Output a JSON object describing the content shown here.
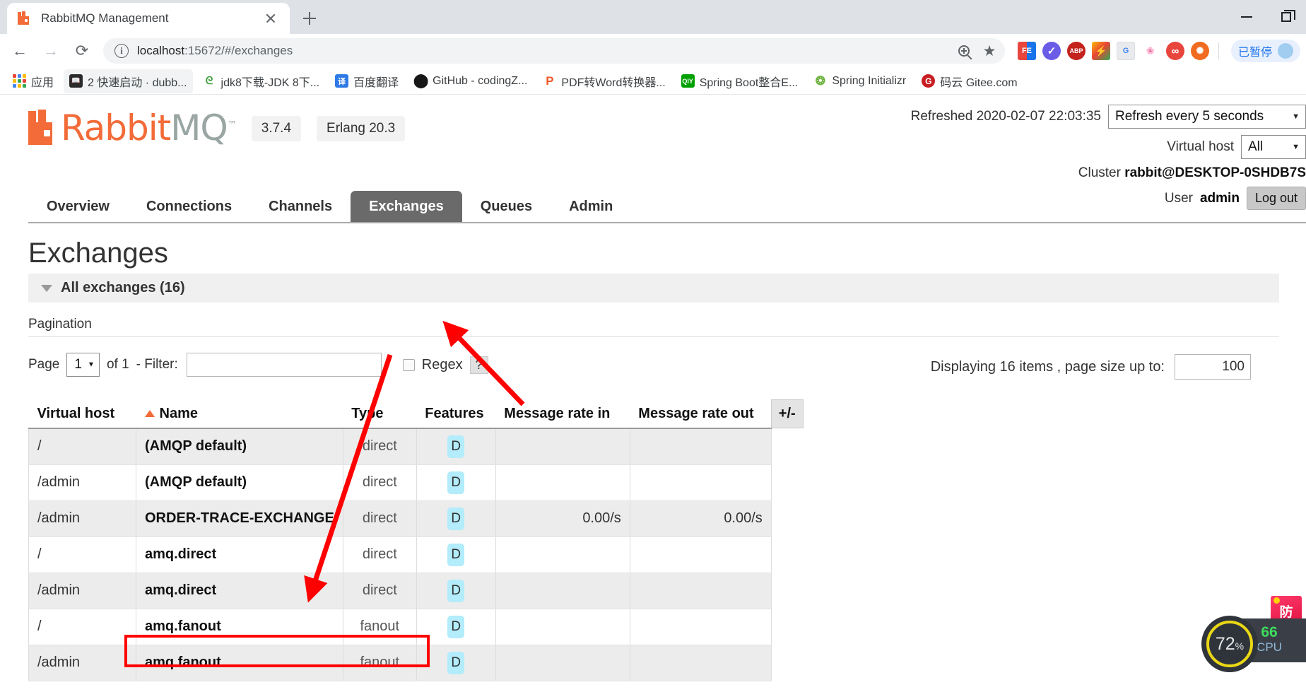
{
  "browser": {
    "tab": {
      "title": "RabbitMQ Management",
      "favicon": "rabbitmq-icon"
    },
    "newtab_label": "+",
    "window_controls": [
      "minimize",
      "maximize"
    ],
    "nav": {
      "back": "←",
      "forward": "→",
      "reload": "⟳"
    },
    "omnibox": {
      "url_host": "localhost",
      "url_rest": ":15672/#/exchanges",
      "info_icon": "ⓘ",
      "zoom_icon": "zoom-in-icon",
      "bookmark_icon": "★"
    },
    "extensions": [
      {
        "name": "fe-helper",
        "glyph": "FE"
      },
      {
        "name": "check-extension",
        "glyph": "✓"
      },
      {
        "name": "adblock-plus",
        "glyph": "ABP"
      },
      {
        "name": "flash-extension",
        "glyph": "⚡"
      },
      {
        "name": "google-translate",
        "glyph": "G"
      },
      {
        "name": "photos-extension",
        "glyph": "✿"
      },
      {
        "name": "infinity-newtab",
        "glyph": "∞"
      },
      {
        "name": "lifebuoy-extension",
        "glyph": "✺"
      }
    ],
    "paused": {
      "label": "已暂停"
    },
    "bookmarks": [
      {
        "label": "应用",
        "icon": "apps-grid-icon",
        "highlight": false
      },
      {
        "label": "2 快速启动 · dubb...",
        "icon": "book-icon",
        "highlight": true
      },
      {
        "label": "jdk8下载-JDK 8下...",
        "icon": "jdk-icon",
        "highlight": false
      },
      {
        "label": "百度翻译",
        "icon": "translate-icon",
        "highlight": false
      },
      {
        "label": "GitHub - codingZ...",
        "icon": "github-icon",
        "highlight": false
      },
      {
        "label": "PDF转Word转换器...",
        "icon": "pdf-icon",
        "highlight": false
      },
      {
        "label": "Spring Boot整合E...",
        "icon": "qiyi-icon",
        "highlight": false
      },
      {
        "label": "Spring Initializr",
        "icon": "spring-icon",
        "highlight": false
      },
      {
        "label": "码云 Gitee.com",
        "icon": "gitee-icon",
        "highlight": false
      }
    ]
  },
  "rabbitmq": {
    "logo": {
      "part_a": "Rabbit",
      "part_b": "MQ",
      "tm": "™"
    },
    "version_badge": "3.7.4",
    "erlang_badge": "Erlang 20.3",
    "refreshed_label": "Refreshed 2020-02-07 22:03:35",
    "refresh_select": "Refresh every 5 seconds",
    "vhost_label": "Virtual host",
    "vhost_select": "All",
    "cluster_label": "Cluster",
    "cluster_name": "rabbit@DESKTOP-0SHDB7S",
    "user_label": "User",
    "user_name": "admin",
    "logout_label": "Log out",
    "tabs": [
      {
        "label": "Overview",
        "active": false
      },
      {
        "label": "Connections",
        "active": false
      },
      {
        "label": "Channels",
        "active": false
      },
      {
        "label": "Exchanges",
        "active": true
      },
      {
        "label": "Queues",
        "active": false
      },
      {
        "label": "Admin",
        "active": false
      }
    ],
    "page_title": "Exchanges",
    "section_label": "All exchanges (16)",
    "pagination_label": "Pagination",
    "page_word": "Page",
    "page_number": "1",
    "of_label": "of 1",
    "filter_label": "- Filter:",
    "filter_value": "",
    "regex_label": "Regex",
    "help_mark": "?",
    "displaying_label": "Displaying 16 items , page size up to:",
    "page_size_value": "100",
    "table": {
      "columns": [
        "Virtual host",
        "Name",
        "Type",
        "Features",
        "Message rate in",
        "Message rate out"
      ],
      "plus_minus": "+/-",
      "sort_column": "Name",
      "rows": [
        {
          "vhost": "/",
          "name": "(AMQP default)",
          "type": "direct",
          "features": "D",
          "rate_in": "",
          "rate_out": ""
        },
        {
          "vhost": "/admin",
          "name": "(AMQP default)",
          "type": "direct",
          "features": "D",
          "rate_in": "",
          "rate_out": ""
        },
        {
          "vhost": "/admin",
          "name": "ORDER-TRACE-EXCHANGE",
          "type": "direct",
          "features": "D",
          "rate_in": "0.00/s",
          "rate_out": "0.00/s"
        },
        {
          "vhost": "/",
          "name": "amq.direct",
          "type": "direct",
          "features": "D",
          "rate_in": "",
          "rate_out": ""
        },
        {
          "vhost": "/admin",
          "name": "amq.direct",
          "type": "direct",
          "features": "D",
          "rate_in": "",
          "rate_out": ""
        },
        {
          "vhost": "/",
          "name": "amq.fanout",
          "type": "fanout",
          "features": "D",
          "rate_in": "",
          "rate_out": ""
        },
        {
          "vhost": "/admin",
          "name": "amq.fanout",
          "type": "fanout",
          "features": "D",
          "rate_in": "",
          "rate_out": ""
        }
      ]
    }
  },
  "annotations": {
    "highlight_target": "ORDER-TRACE-EXCHANGE row name and type cells",
    "arrow_color": "#ff0000",
    "arrows": [
      {
        "name": "arrow-to-exchanges-tab",
        "from": [
          740,
          440
        ],
        "to": [
          630,
          330
        ]
      },
      {
        "name": "arrow-to-order-trace-exchange",
        "from": [
          552,
          370
        ],
        "to": [
          435,
          700
        ]
      }
    ]
  },
  "monitor_widget": {
    "percent": "72",
    "percent_symbol": "%",
    "cpu_value": "66",
    "cpu_label": "CPU",
    "flag_text": "防",
    "ring_color": "#ead715"
  }
}
